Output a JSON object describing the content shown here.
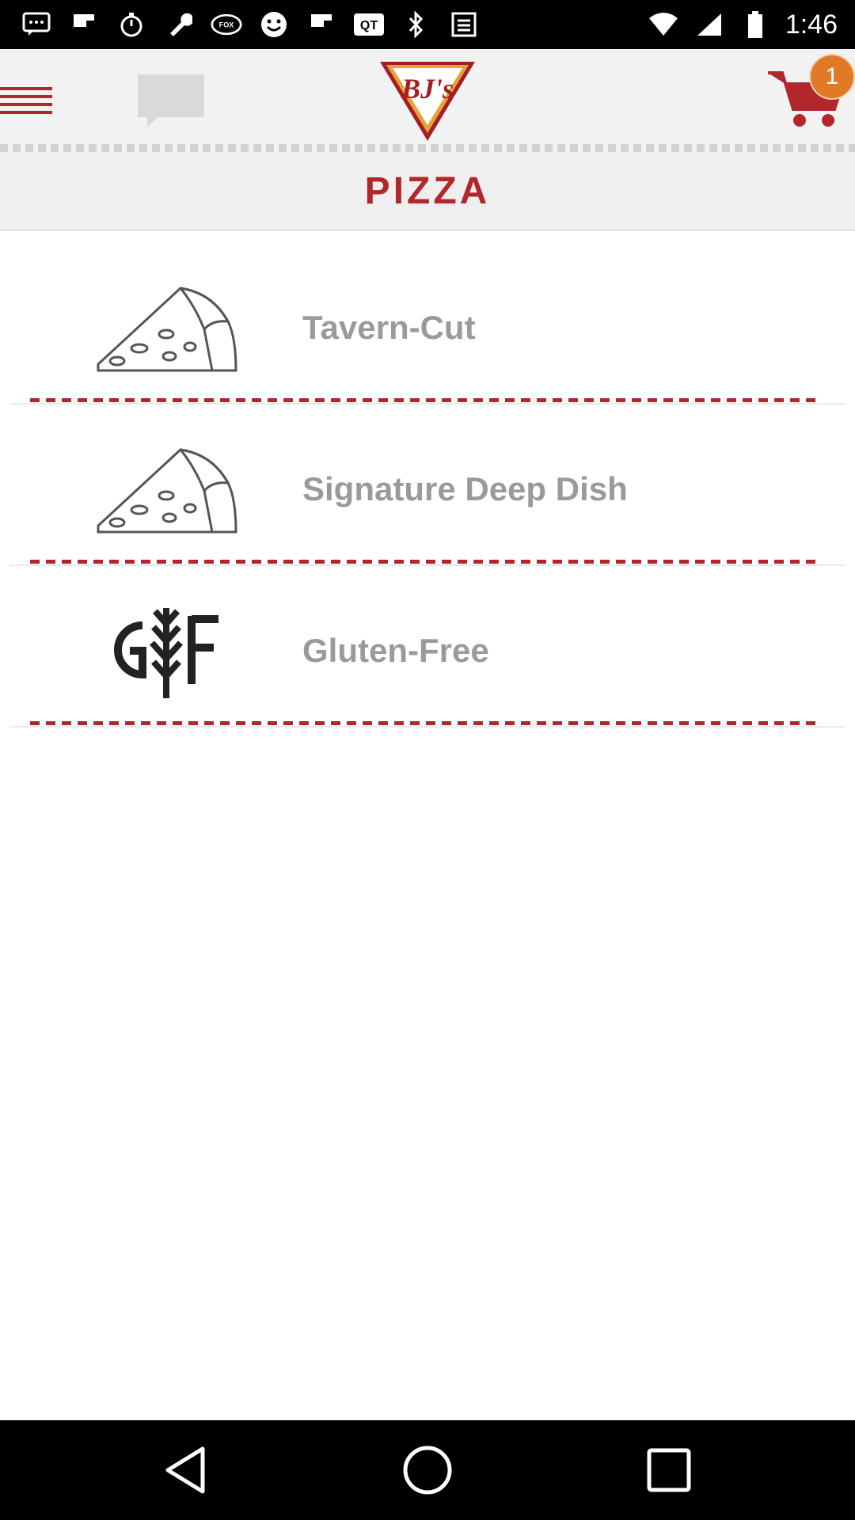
{
  "status_bar": {
    "time": "1:46",
    "icons": [
      "messages-icon",
      "flipboard-icon",
      "timer-icon",
      "wrench-icon",
      "fox-sports-icon",
      "smiley-icon",
      "flipboard-icon",
      "qt-icon",
      "bluetooth-icon",
      "app-icon",
      "wifi-icon",
      "signal-icon",
      "battery-icon"
    ]
  },
  "header": {
    "logo_text": "BJ's",
    "cart_count": "1"
  },
  "category": {
    "title": "PIZZA"
  },
  "menu_items": [
    {
      "label": "Tavern-Cut",
      "icon": "pizza-slice-icon"
    },
    {
      "label": "Signature Deep Dish",
      "icon": "pizza-slice-icon"
    },
    {
      "label": "Gluten-Free",
      "icon": "gluten-free-icon"
    }
  ],
  "colors": {
    "accent": "#b3262b",
    "badge": "#e07a26",
    "item_text": "#9a9a9a"
  }
}
